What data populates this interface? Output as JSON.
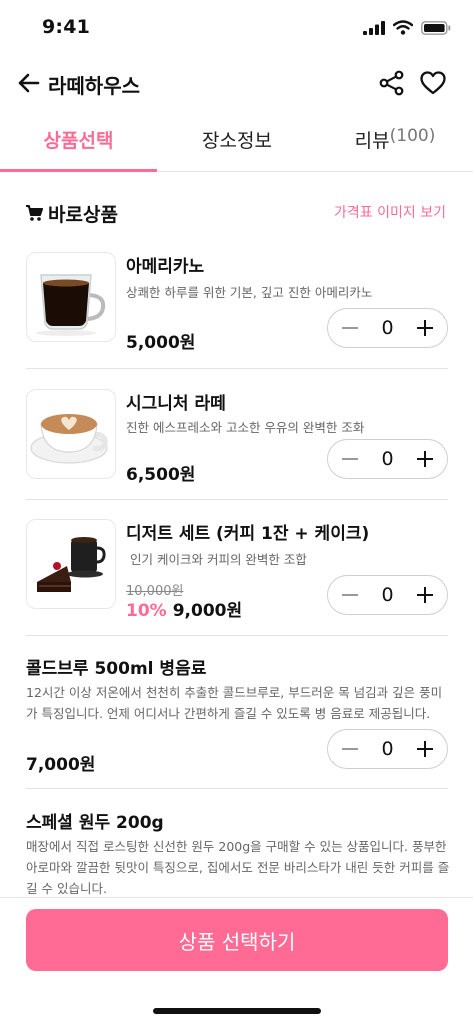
{
  "status_bar": {
    "time": "9:41"
  },
  "header": {
    "title": "라떼하우스"
  },
  "tabs": [
    {
      "label": "상품선택",
      "count": ""
    },
    {
      "label": "장소정보",
      "count": ""
    },
    {
      "label": "리뷰",
      "count": "(100)"
    }
  ],
  "section": {
    "title": "바로상품",
    "link_label": "가격표 이미지 보기"
  },
  "products": [
    {
      "name": "아메리카노",
      "desc": "상쾌한 하루를 위한 기본, 깊고 진한 아메리카노",
      "price": "5,000원",
      "qty": "0"
    },
    {
      "name": "시그니처 라떼",
      "desc": "진한 에스프레소와 고소한 우유의 완벽한 조화",
      "price": "6,500원",
      "qty": "0"
    },
    {
      "name": "디저트 세트 (커피 1잔 + 케이크)",
      "desc": "인기 케이크와 커피의 완벽한 조합",
      "old_price": "10,000원",
      "discount": "10%",
      "price": "9,000원",
      "qty": "0"
    }
  ],
  "wide_products": [
    {
      "name": "콜드브루 500ml 병음료",
      "desc": "12시간 이상 저온에서 천천히 추출한 콜드브루로, 부드러운 목 넘김과 깊은 풍미가 특징입니다. 언제 어디서나 간편하게 즐길 수 있도록 병 음료로 제공됩니다.",
      "price": "7,000원",
      "qty": "0"
    },
    {
      "name": "스페셜 원두 200g",
      "desc": "매장에서 직접 로스팅한 신선한 원두 200g을 구매할 수 있는 상품입니다. 풍부한 아로마와 깔끔한 뒷맛이 특징으로, 집에서도 전문 바리스타가 내린 듯한 커피를 즐길 수 있습니다."
    }
  ],
  "cta": {
    "label": "상품 선택하기"
  },
  "colors": {
    "accent": "#ff6b95",
    "divider": "#e3e3e3",
    "text": "#111111"
  }
}
